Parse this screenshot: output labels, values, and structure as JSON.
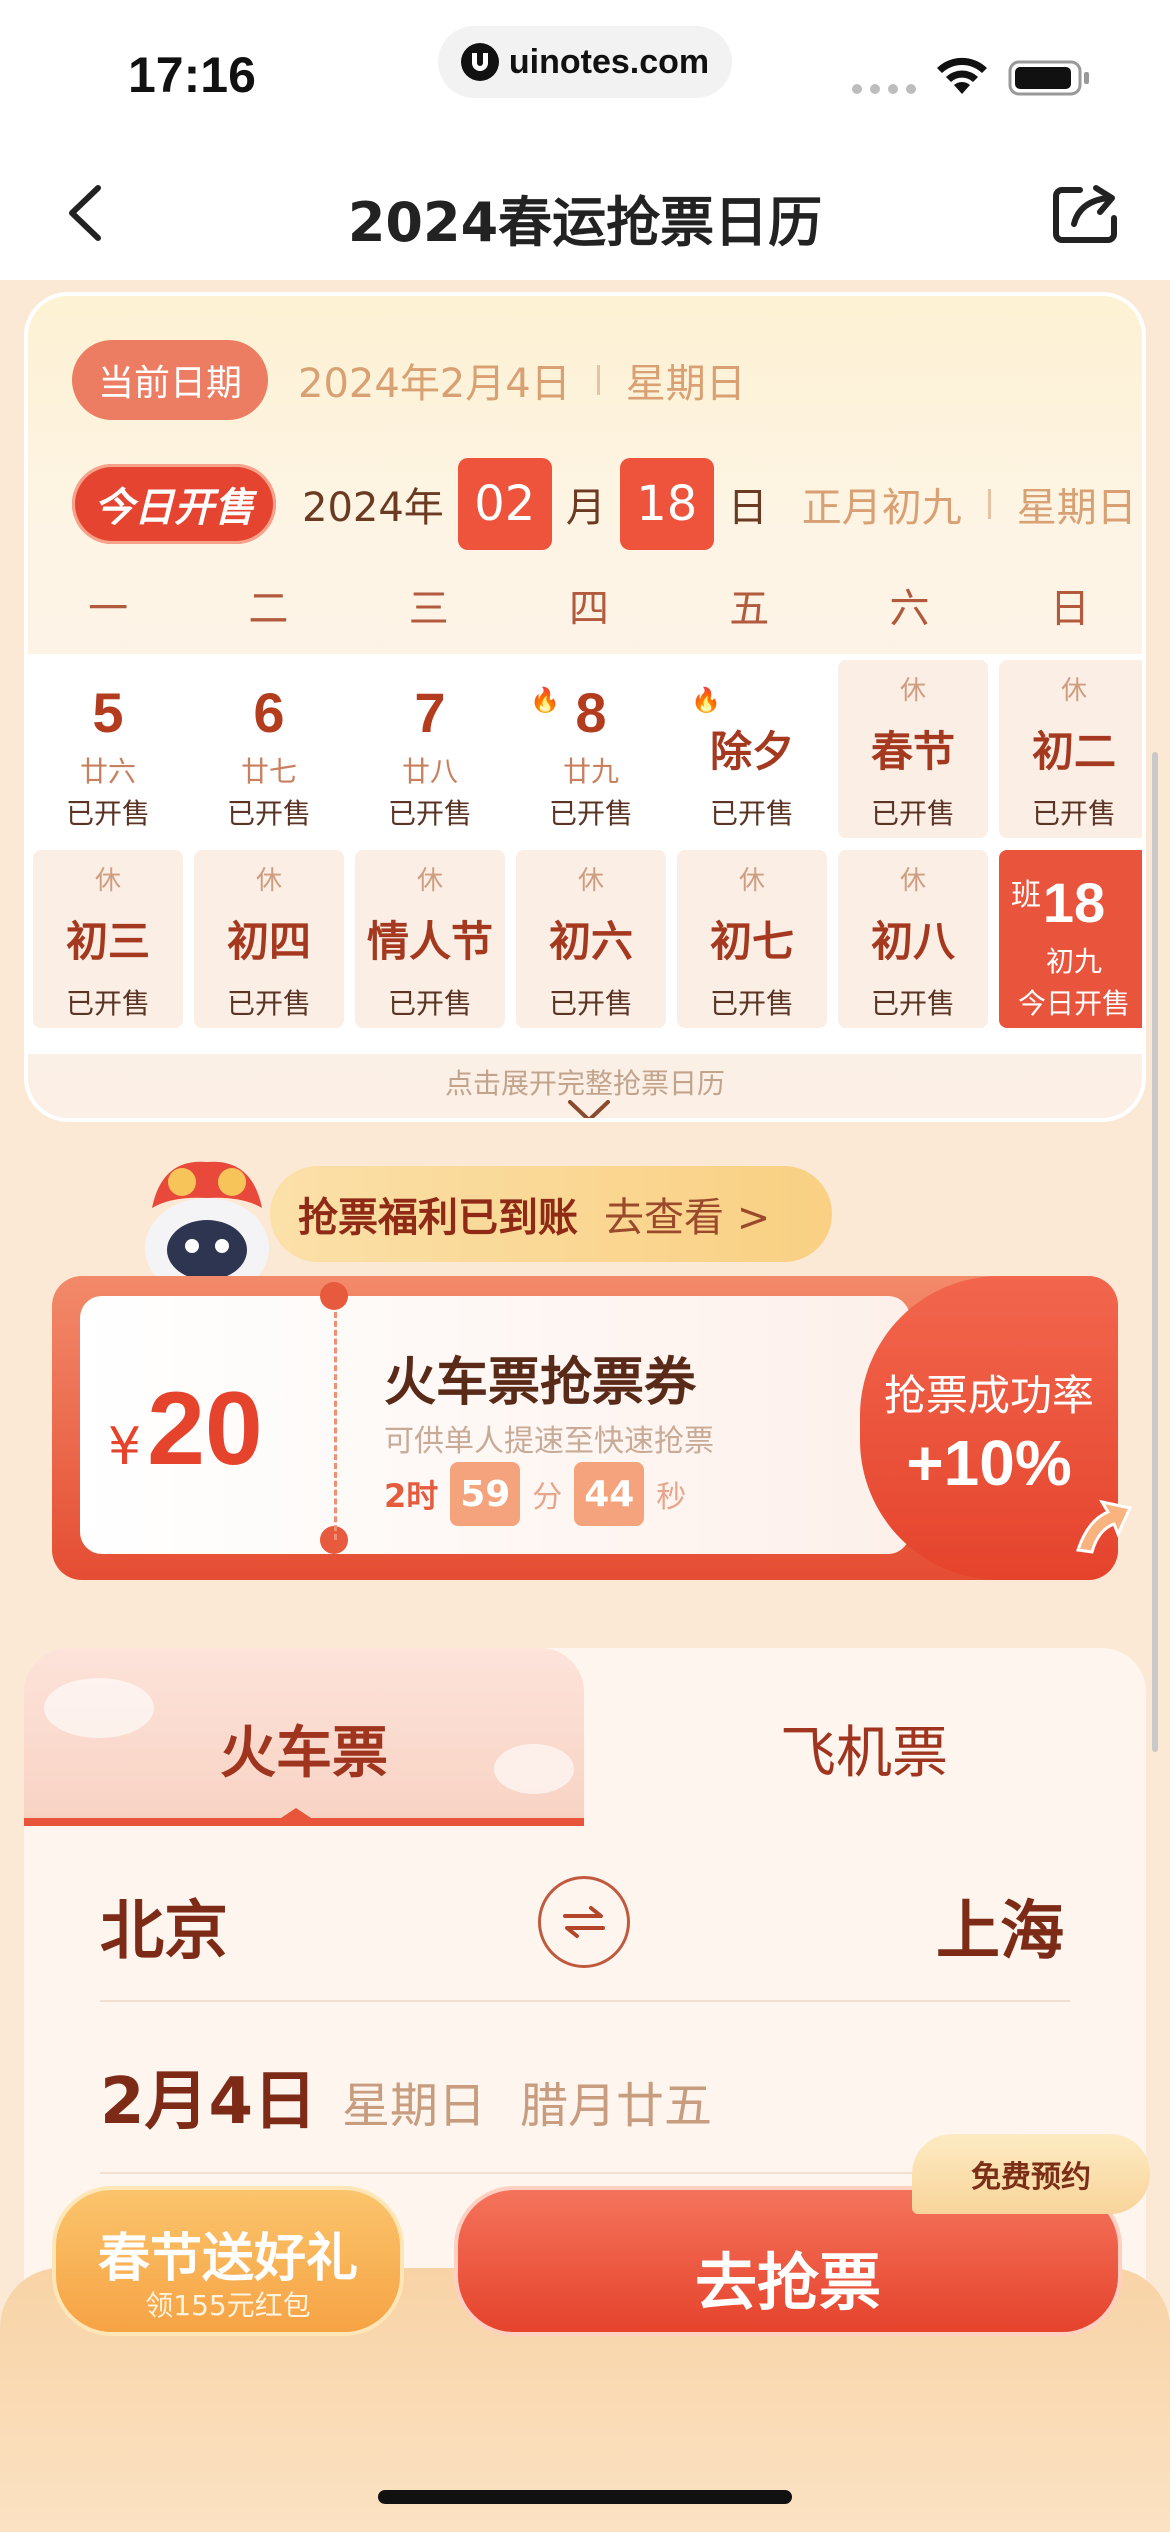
{
  "status_bar": {
    "time": "17:16",
    "url": "uinotes.com"
  },
  "nav": {
    "title": "2024春运抢票日历"
  },
  "calendar": {
    "current_date_label": "当前日期",
    "current_date": "2024年2月4日",
    "current_weekday": "星期日",
    "sale_label": "今日开售",
    "sale_year": "2024年",
    "sale_month": "02",
    "month_unit": "月",
    "sale_day": "18",
    "day_unit": "日",
    "sale_lunar": "正月初九",
    "sale_weekday": "星期日",
    "weekdays": [
      "一",
      "二",
      "三",
      "四",
      "五",
      "六",
      "日"
    ],
    "days": [
      {
        "num": "5",
        "lunar": "廿六",
        "big": "",
        "tag": "",
        "fire": false,
        "status": "已开售",
        "rest": false,
        "today": false
      },
      {
        "num": "6",
        "lunar": "廿七",
        "big": "",
        "tag": "",
        "fire": false,
        "status": "已开售",
        "rest": false,
        "today": false
      },
      {
        "num": "7",
        "lunar": "廿八",
        "big": "",
        "tag": "",
        "fire": false,
        "status": "已开售",
        "rest": false,
        "today": false
      },
      {
        "num": "8",
        "lunar": "廿九",
        "big": "",
        "tag": "",
        "fire": true,
        "status": "已开售",
        "rest": false,
        "today": false
      },
      {
        "num": "",
        "lunar": "",
        "big": "除夕",
        "tag": "",
        "fire": true,
        "status": "已开售",
        "rest": false,
        "today": false
      },
      {
        "num": "",
        "lunar": "",
        "big": "春节",
        "tag": "休",
        "fire": false,
        "status": "已开售",
        "rest": true,
        "today": false
      },
      {
        "num": "",
        "lunar": "",
        "big": "初二",
        "tag": "休",
        "fire": false,
        "status": "已开售",
        "rest": true,
        "today": false
      },
      {
        "num": "",
        "lunar": "",
        "big": "初三",
        "tag": "休",
        "fire": false,
        "status": "已开售",
        "rest": true,
        "today": false
      },
      {
        "num": "",
        "lunar": "",
        "big": "初四",
        "tag": "休",
        "fire": false,
        "status": "已开售",
        "rest": true,
        "today": false
      },
      {
        "num": "",
        "lunar": "",
        "big": "情人节",
        "tag": "休",
        "fire": false,
        "status": "已开售",
        "rest": true,
        "today": false
      },
      {
        "num": "",
        "lunar": "",
        "big": "初六",
        "tag": "休",
        "fire": false,
        "status": "已开售",
        "rest": true,
        "today": false
      },
      {
        "num": "",
        "lunar": "",
        "big": "初七",
        "tag": "休",
        "fire": false,
        "status": "已开售",
        "rest": true,
        "today": false
      },
      {
        "num": "",
        "lunar": "",
        "big": "初八",
        "tag": "休",
        "fire": false,
        "status": "已开售",
        "rest": true,
        "today": false
      },
      {
        "num": "18",
        "lunar": "初九",
        "big": "",
        "tag": "班",
        "fire": false,
        "status": "今日开售",
        "rest": false,
        "today": true
      }
    ],
    "expand_hint": "点击展开完整抢票日历"
  },
  "benefit": {
    "title": "抢票福利已到账",
    "link": "去查看 >"
  },
  "coupon": {
    "currency": "¥",
    "amount": "20",
    "title": "火车票抢票券",
    "subtitle": "可供单人提速至快速抢票",
    "hours": "2时",
    "minutes": "59",
    "minutes_unit": "分",
    "seconds": "44",
    "seconds_unit": "秒",
    "rate_label": "抢票成功率",
    "rate_value": "+10%"
  },
  "booking": {
    "tabs": [
      "火车票",
      "飞机票"
    ],
    "from_city": "北京",
    "to_city": "上海",
    "date": "2月4日",
    "weekday": "星期日",
    "lunar": "腊月廿五"
  },
  "actions": {
    "gift_title": "春节送好礼",
    "gift_sub": "领155元红包",
    "grab_label": "去抢票",
    "free_badge": "免费预约"
  },
  "colors": {
    "accent": "#e8553b",
    "brown_text": "#7d2a17",
    "gold_text": "#d9a173"
  }
}
